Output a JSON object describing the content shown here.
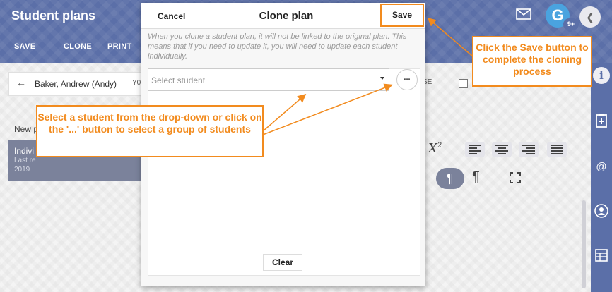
{
  "app": {
    "title": "Student plans",
    "avatar_letter": "G",
    "notification_badge": "9+"
  },
  "toolbar": {
    "save": "SAVE",
    "clone": "CLONE",
    "print": "PRINT"
  },
  "student_bar": {
    "student_name": "Baker, Andrew (Andy)",
    "year_fragment": "Y0",
    "right_fragment": "SE"
  },
  "plans": {
    "new_label": "New p",
    "card_title": "Indivi",
    "card_line2": "Last re",
    "card_line3": "2019"
  },
  "formatting": {
    "superscript": "X",
    "superscript_sup": "2"
  },
  "modal": {
    "cancel_label": "Cancel",
    "title": "Clone plan",
    "save_label": "Save",
    "note": "When you clone a student plan, it will not be linked to the original plan. This means that if you need to update it, you will need to update each student individually.",
    "select_placeholder": "Select student",
    "more_label": "...",
    "clear_label": "Clear"
  },
  "callouts": {
    "save_hint": "Click the Save button to complete the cloning process",
    "select_hint": "Select a student from the drop-down or click on the '...'  button to select a group of students"
  },
  "colors": {
    "header": "#5b6fa8",
    "callout_accent": "#f28b1e",
    "avatar": "#4aa3df"
  }
}
